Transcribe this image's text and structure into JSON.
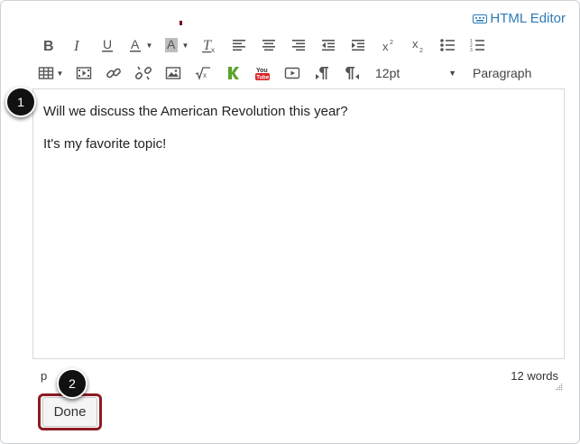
{
  "header": {
    "html_editor_label": "HTML Editor"
  },
  "toolbar": {
    "row1": [
      {
        "name": "bold-button",
        "icon": "bold-icon"
      },
      {
        "name": "italic-button",
        "icon": "italic-icon"
      },
      {
        "name": "underline-button",
        "icon": "underline-icon"
      },
      {
        "name": "text-color-button",
        "icon": "text-color-icon"
      },
      {
        "name": "background-color-button",
        "icon": "background-color-icon"
      },
      {
        "name": "clear-formatting-button",
        "icon": "clear-formatting-icon"
      },
      {
        "name": "align-left-button",
        "icon": "align-left-icon"
      },
      {
        "name": "align-center-button",
        "icon": "align-center-icon"
      },
      {
        "name": "align-right-button",
        "icon": "align-right-icon"
      },
      {
        "name": "outdent-button",
        "icon": "outdent-icon"
      },
      {
        "name": "indent-button",
        "icon": "indent-icon"
      },
      {
        "name": "superscript-button",
        "icon": "superscript-icon"
      },
      {
        "name": "subscript-button",
        "icon": "subscript-icon"
      },
      {
        "name": "bullet-list-button",
        "icon": "bullet-list-icon"
      },
      {
        "name": "numbered-list-button",
        "icon": "numbered-list-icon"
      }
    ],
    "row2": [
      {
        "name": "table-button",
        "icon": "table-icon"
      },
      {
        "name": "media-button",
        "icon": "media-icon"
      },
      {
        "name": "link-button",
        "icon": "link-icon"
      },
      {
        "name": "unlink-button",
        "icon": "unlink-icon"
      },
      {
        "name": "image-button",
        "icon": "image-icon"
      },
      {
        "name": "equation-button",
        "icon": "equation-icon"
      },
      {
        "name": "k-app-button",
        "icon": "k-app-icon"
      },
      {
        "name": "youtube-button",
        "icon": "youtube-icon"
      },
      {
        "name": "video-button",
        "icon": "video-icon"
      },
      {
        "name": "ltr-button",
        "icon": "ltr-icon"
      },
      {
        "name": "rtl-button",
        "icon": "rtl-icon"
      }
    ],
    "font_size": "12pt",
    "paragraph_format": "Paragraph"
  },
  "editor": {
    "paragraph_1": "Will we discuss the American Revolution this year?",
    "paragraph_2": "It's my favorite topic!"
  },
  "status_bar": {
    "path": "p",
    "word_count": "12 words"
  },
  "callouts": {
    "badge_1": "1",
    "badge_2": "2"
  },
  "actions": {
    "done_label": "Done"
  },
  "colors": {
    "accent_link": "#2d7bb6",
    "highlight_outline": "#8e1b24",
    "youtube_red": "#d8262a",
    "k_green": "#5aa32b"
  }
}
